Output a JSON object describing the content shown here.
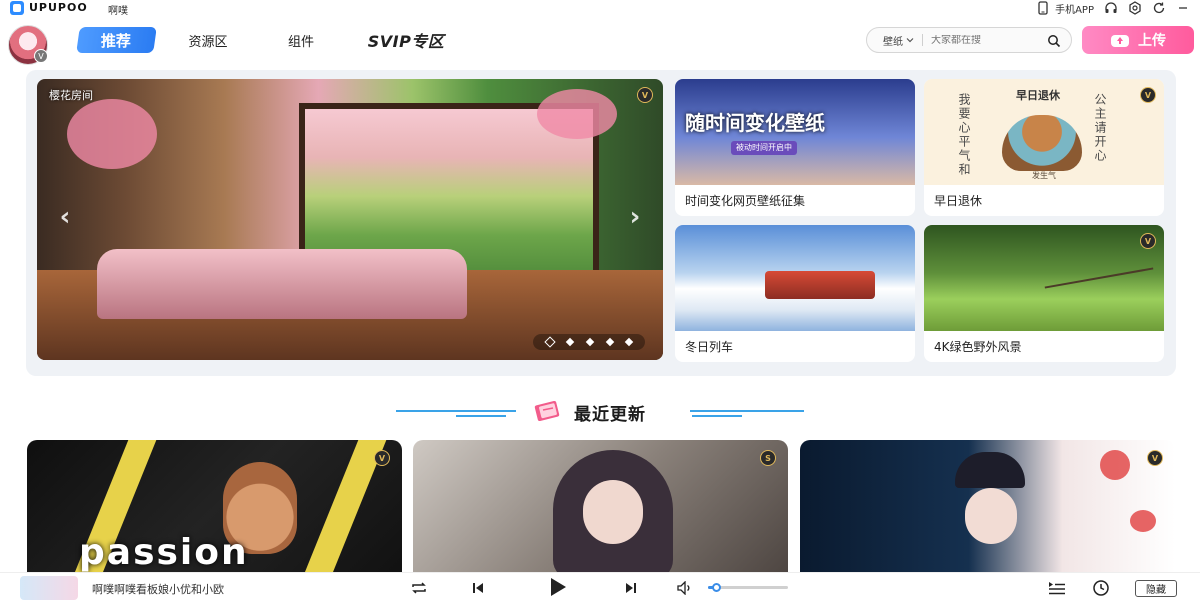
{
  "titlebar": {
    "logo_text": "UPUPOO",
    "user_name": "啊噗",
    "mobile_app_label": "手机APP"
  },
  "nav": {
    "tabs": [
      {
        "label": "推荐",
        "active": true
      },
      {
        "label": "资源区"
      },
      {
        "label": "组件"
      },
      {
        "label": "SVIP专区"
      }
    ],
    "search": {
      "type_label": "壁纸",
      "placeholder": "大家都在搜"
    },
    "upload_label": "上传",
    "avatar_badge": "V"
  },
  "featured": {
    "hero": {
      "title": "樱花房间",
      "badge": "V",
      "dots": 5,
      "active_dot": 0
    },
    "cards": [
      {
        "caption": "时间变化网页壁纸征集",
        "image_text": "随时间变化壁纸",
        "image_subtext": "被动时间开启中"
      },
      {
        "caption": "早日退休",
        "badge": "V",
        "image_title": "早日退休",
        "image_left_text": "我要心平气和",
        "image_right_text": "公主请开心",
        "image_small": "发生气"
      },
      {
        "caption": "冬日列车"
      },
      {
        "caption": "4K绿色野外风景",
        "badge": "V"
      }
    ]
  },
  "section": {
    "title": "最近更新"
  },
  "recent": [
    {
      "overlay_text": "passion",
      "badge": "V"
    },
    {
      "badge": "S"
    },
    {
      "badge": "V"
    }
  ],
  "player": {
    "now_playing": "啊噗啊噗看板娘小优和小欧",
    "volume": 0.1,
    "hide_label": "隐藏"
  },
  "colors": {
    "accent_blue": "#2b7cf2",
    "upload_pink": "#ff5b9d",
    "panel_bg": "#eff2f6",
    "badge_gold": "#e0b85a"
  },
  "icons": {
    "headset": "headset-icon",
    "settings": "gear-icon",
    "refresh": "refresh-icon",
    "minimize": "minimize-icon",
    "search": "search-icon",
    "repeat": "repeat-icon",
    "prev": "skip-previous-icon",
    "play": "play-icon",
    "next": "skip-next-icon",
    "volume": "volume-icon",
    "playlist": "playlist-icon",
    "history": "history-icon"
  }
}
